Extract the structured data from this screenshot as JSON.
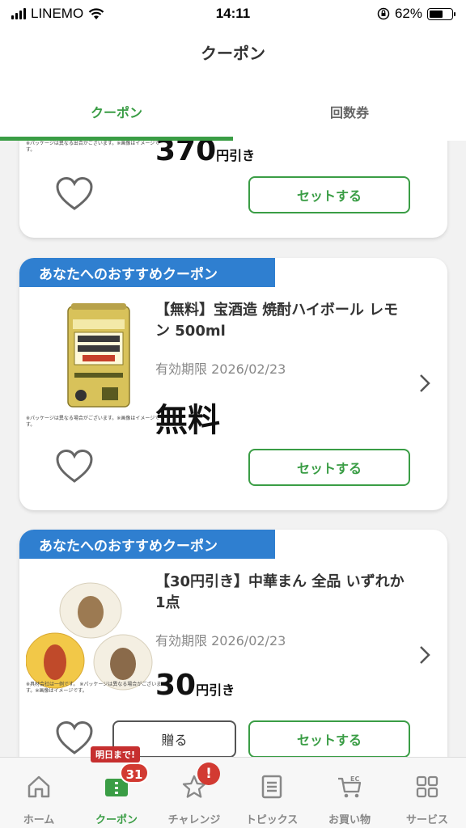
{
  "status_bar": {
    "carrier": "LINEMO",
    "time": "14:11",
    "battery_percent": "62%",
    "battery_level": 0.62
  },
  "header": {
    "title": "クーポン"
  },
  "tabs": [
    {
      "label": "クーポン",
      "active": true
    },
    {
      "label": "回数券",
      "active": false
    }
  ],
  "coupons": [
    {
      "product_note": "※パッケージは異なる出合がございます。※画像はイメージです。",
      "discount_value": "370",
      "discount_unit": "円引き",
      "set_label": "セットする",
      "icon": "heart-icon"
    },
    {
      "banner": "あなたへのおすすめクーポン",
      "name": "【無料】宝酒造 焼酎ハイボール レモン 500ml",
      "expiry": "有効期限 2026/02/23",
      "discount_text": "無料",
      "product_note": "※パッケージは異なる場合がございます。※画像はイメージです。",
      "set_label": "セットする",
      "icon": "heart-icon"
    },
    {
      "banner": "あなたへのおすすめクーポン",
      "name": "【30円引き】中華まん 全品 いずれか1点",
      "expiry": "有効期限 2026/02/23",
      "discount_value": "30",
      "discount_unit": "円引き",
      "product_note": "※具材会社は一例です。 ※パッケージは異なる場合がございます。※画像はイメージです。",
      "gift_label": "贈る",
      "set_label": "セットする",
      "icon": "heart-icon"
    }
  ],
  "bottom_nav": [
    {
      "label": "ホーム",
      "icon": "home-icon"
    },
    {
      "label": "クーポン",
      "icon": "coupon-icon",
      "active": true,
      "deadline_badge": "明日まで!",
      "count_badge": "31"
    },
    {
      "label": "チャレンジ",
      "icon": "star-icon",
      "alert_badge": "!"
    },
    {
      "label": "トピックス",
      "icon": "document-icon"
    },
    {
      "label": "お買い物",
      "icon": "cart-icon",
      "icon_text": "EC"
    },
    {
      "label": "サービス",
      "icon": "grid-icon"
    }
  ],
  "colors": {
    "accent_green": "#3a9d45",
    "banner_blue": "#2f7fd0",
    "badge_red": "#d23a32"
  }
}
